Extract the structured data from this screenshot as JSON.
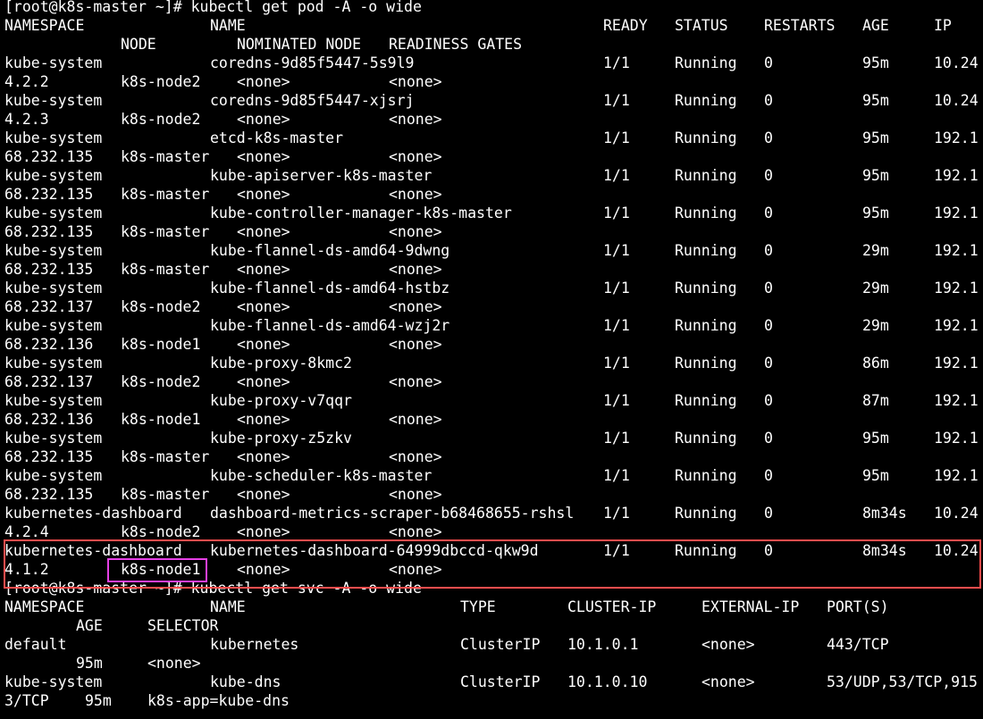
{
  "terminal": {
    "background": "#000000",
    "foreground": "#ffffff",
    "highlight_colors": {
      "row_box": "#ff4d4d",
      "node_box": "#e640e6"
    },
    "lines": [
      {
        "cells": [
          "[root@k8s-master ~]# kubectl get pod -A -o wide"
        ]
      },
      {
        "cells": [
          "NAMESPACE",
          "NAME",
          "READY",
          "STATUS",
          "RESTARTS",
          "AGE",
          "IP"
        ]
      },
      {
        "cells": [
          "NODE",
          "NOMINATED NODE",
          "READINESS GATES"
        ]
      },
      {
        "cells": [
          "kube-system",
          "coredns-9d85f5447-5s9l9",
          "1/1",
          "Running",
          "0",
          "95m",
          "10.24"
        ]
      },
      {
        "cells": [
          "4.2.2",
          "k8s-node2",
          "<none>",
          "<none>"
        ]
      },
      {
        "cells": [
          "kube-system",
          "coredns-9d85f5447-xjsrj",
          "1/1",
          "Running",
          "0",
          "95m",
          "10.24"
        ]
      },
      {
        "cells": [
          "4.2.3",
          "k8s-node2",
          "<none>",
          "<none>"
        ]
      },
      {
        "cells": [
          "kube-system",
          "etcd-k8s-master",
          "1/1",
          "Running",
          "0",
          "95m",
          "192.1"
        ]
      },
      {
        "cells": [
          "68.232.135",
          "k8s-master",
          "<none>",
          "<none>"
        ]
      },
      {
        "cells": [
          "kube-system",
          "kube-apiserver-k8s-master",
          "1/1",
          "Running",
          "0",
          "95m",
          "192.1"
        ]
      },
      {
        "cells": [
          "68.232.135",
          "k8s-master",
          "<none>",
          "<none>"
        ]
      },
      {
        "cells": [
          "kube-system",
          "kube-controller-manager-k8s-master",
          "1/1",
          "Running",
          "0",
          "95m",
          "192.1"
        ]
      },
      {
        "cells": [
          "68.232.135",
          "k8s-master",
          "<none>",
          "<none>"
        ]
      },
      {
        "cells": [
          "kube-system",
          "kube-flannel-ds-amd64-9dwng",
          "1/1",
          "Running",
          "0",
          "29m",
          "192.1"
        ]
      },
      {
        "cells": [
          "68.232.135",
          "k8s-master",
          "<none>",
          "<none>"
        ]
      },
      {
        "cells": [
          "kube-system",
          "kube-flannel-ds-amd64-hstbz",
          "1/1",
          "Running",
          "0",
          "29m",
          "192.1"
        ]
      },
      {
        "cells": [
          "68.232.137",
          "k8s-node2",
          "<none>",
          "<none>"
        ]
      },
      {
        "cells": [
          "kube-system",
          "kube-flannel-ds-amd64-wzj2r",
          "1/1",
          "Running",
          "0",
          "29m",
          "192.1"
        ]
      },
      {
        "cells": [
          "68.232.136",
          "k8s-node1",
          "<none>",
          "<none>"
        ]
      },
      {
        "cells": [
          "kube-system",
          "kube-proxy-8kmc2",
          "1/1",
          "Running",
          "0",
          "86m",
          "192.1"
        ]
      },
      {
        "cells": [
          "68.232.137",
          "k8s-node2",
          "<none>",
          "<none>"
        ]
      },
      {
        "cells": [
          "kube-system",
          "kube-proxy-v7qqr",
          "1/1",
          "Running",
          "0",
          "87m",
          "192.1"
        ]
      },
      {
        "cells": [
          "68.232.136",
          "k8s-node1",
          "<none>",
          "<none>"
        ]
      },
      {
        "cells": [
          "kube-system",
          "kube-proxy-z5zkv",
          "1/1",
          "Running",
          "0",
          "95m",
          "192.1"
        ]
      },
      {
        "cells": [
          "68.232.135",
          "k8s-master",
          "<none>",
          "<none>"
        ]
      },
      {
        "cells": [
          "kube-system",
          "kube-scheduler-k8s-master",
          "1/1",
          "Running",
          "0",
          "95m",
          "192.1"
        ]
      },
      {
        "cells": [
          "68.232.135",
          "k8s-master",
          "<none>",
          "<none>"
        ]
      },
      {
        "cells": [
          "kubernetes-dashboard",
          "dashboard-metrics-scraper-b68468655-rshsl",
          "1/1",
          "Running",
          "0",
          "8m34s",
          "10.24"
        ]
      },
      {
        "cells": [
          "4.2.4",
          "k8s-node2",
          "<none>",
          "<none>"
        ]
      },
      {
        "cells": [
          "kubernetes-dashboard",
          "kubernetes-dashboard-64999dbccd-qkw9d",
          "1/1",
          "Running",
          "0",
          "8m34s",
          "10.24"
        ]
      },
      {
        "cells": [
          "4.1.2",
          "k8s-node1",
          "<none>",
          "<none>"
        ]
      },
      {
        "cells": [
          "[root@k8s-master ~]# kubectl get svc -A -o wide"
        ]
      },
      {
        "cells": [
          "NAMESPACE",
          "NAME",
          "TYPE",
          "CLUSTER-IP",
          "EXTERNAL-IP",
          "PORT(S)"
        ]
      },
      {
        "cells": [
          "AGE",
          "SELECTOR"
        ]
      },
      {
        "cells": [
          "default",
          "kubernetes",
          "ClusterIP",
          "10.1.0.1",
          "<none>",
          "443/TCP"
        ]
      },
      {
        "cells": [
          "95m",
          "<none>"
        ]
      },
      {
        "cells": [
          "kube-system",
          "kube-dns",
          "ClusterIP",
          "10.1.0.10",
          "<none>",
          "53/UDP,53/TCP,915"
        ]
      },
      {
        "cells": [
          "3/TCP",
          "95m",
          "k8s-app=kube-dns"
        ]
      }
    ]
  }
}
